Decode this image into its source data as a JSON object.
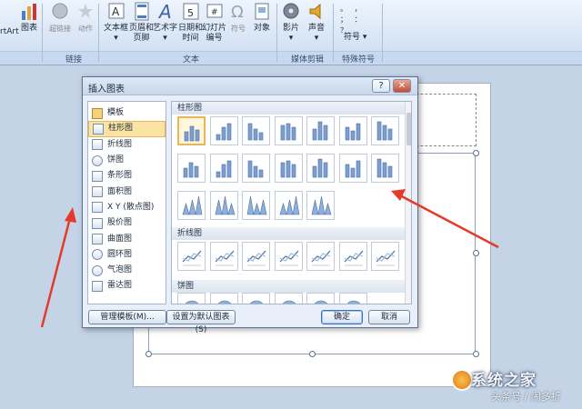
{
  "ribbon": {
    "buttons": {
      "smartart": "rtArt",
      "chart": "图表",
      "hyperlink": "超链接",
      "action": "动作",
      "textbox_1": "文本框",
      "textbox_2": "▾",
      "header_footer_1": "页眉和",
      "header_footer_2": "页脚",
      "wordart_1": "艺术字",
      "wordart_2": "▾",
      "datetime_1": "日期和",
      "datetime_2": "时间",
      "slide_number_1": "幻灯片",
      "slide_number_2": "编号",
      "symbol": "符号",
      "object": "对象",
      "movie_1": "影片",
      "movie_2": "▾",
      "sound_1": "声音",
      "sound_2": "▾",
      "special_symbol": "符号",
      "special_symbol_arrow": "▾"
    },
    "groups": {
      "links": "链接",
      "text": "文本",
      "media": "媒体剪辑",
      "special": "特殊符号"
    },
    "dots": [
      "。",
      "，",
      "；",
      "：",
      "？"
    ]
  },
  "dialog": {
    "title": "插入图表",
    "help": "?",
    "close": "✕",
    "categories": [
      {
        "label": "模板",
        "icon": "folder-icon"
      },
      {
        "label": "柱形图",
        "icon": "column-chart-icon"
      },
      {
        "label": "折线图",
        "icon": "line-chart-icon"
      },
      {
        "label": "饼图",
        "icon": "pie-chart-icon"
      },
      {
        "label": "条形图",
        "icon": "bar-chart-icon"
      },
      {
        "label": "面积图",
        "icon": "area-chart-icon"
      },
      {
        "label": "X Y (散点图)",
        "icon": "scatter-chart-icon"
      },
      {
        "label": "股价图",
        "icon": "stock-chart-icon"
      },
      {
        "label": "曲面图",
        "icon": "surface-chart-icon"
      },
      {
        "label": "圆环图",
        "icon": "doughnut-chart-icon"
      },
      {
        "label": "气泡图",
        "icon": "bubble-chart-icon"
      },
      {
        "label": "雷达图",
        "icon": "radar-chart-icon"
      }
    ],
    "selected_category": 1,
    "sections": {
      "column": "柱形图",
      "line": "折线图",
      "pie": "饼图"
    },
    "buttons": {
      "manage_templates": "管理模板(M)...",
      "set_default": "设置为默认图表(S)",
      "ok": "确定",
      "cancel": "取消"
    }
  },
  "watermark": {
    "main": "系统之家",
    "sub": "头条号 / 闹多折"
  },
  "colors": {
    "annotation_arrow": "#e53a2a",
    "selection": "#fbe3a4",
    "ribbon": "#d5e3f4"
  }
}
